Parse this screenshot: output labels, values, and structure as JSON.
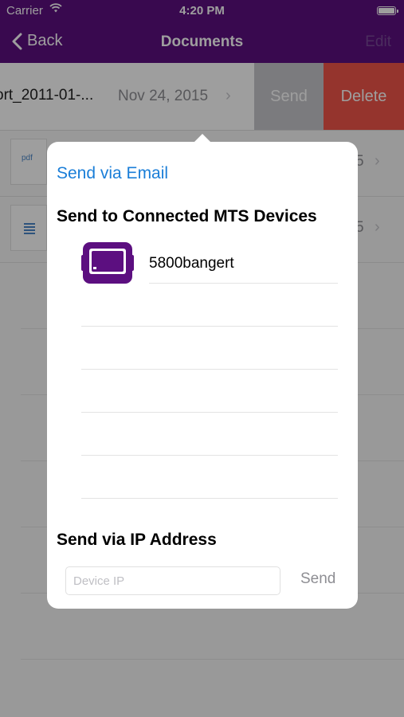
{
  "status_bar": {
    "carrier": "Carrier",
    "time": "4:20 PM"
  },
  "nav": {
    "back_label": "Back",
    "title": "Documents",
    "edit_label": "Edit"
  },
  "documents": {
    "rows": [
      {
        "name": "ort_2011-01-...",
        "date": "Nov 24, 2015",
        "swipe_send": "Send",
        "swipe_delete": "Delete"
      },
      {
        "thumb": "pdf",
        "thumb_label": "pdf",
        "date_fragment": "5"
      },
      {
        "thumb": "doc",
        "thumb_label": "",
        "date_fragment": "5"
      }
    ]
  },
  "popover": {
    "email_label": "Send via Email",
    "connected_title": "Send to Connected MTS Devices",
    "devices": [
      {
        "name": "5800bangert",
        "icon": "mts-device-icon"
      }
    ],
    "ip_title": "Send via IP Address",
    "ip_placeholder": "Device IP",
    "ip_send_label": "Send"
  },
  "colors": {
    "nav": "#5c0f80",
    "delete": "#f0544a",
    "swipe_send": "#c7c7cc",
    "link": "#1a7ed8",
    "device_icon": "#5c0f80"
  }
}
